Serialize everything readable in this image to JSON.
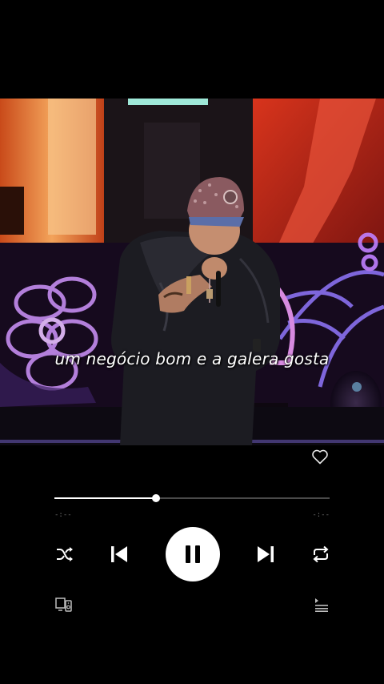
{
  "video": {
    "lyric_caption": "um negócio bom e a galera gosta"
  },
  "player": {
    "progress_fraction": 0.37,
    "elapsed_time": "-:--",
    "remaining_time": "-:--",
    "state": "playing"
  },
  "icons": {
    "like": "heart-outline-icon",
    "shuffle": "shuffle-icon",
    "previous": "skip-previous-icon",
    "pause": "pause-icon",
    "next": "skip-next-icon",
    "repeat": "repeat-icon",
    "devices": "connect-device-icon",
    "queue": "queue-list-icon"
  },
  "colors": {
    "background": "#000000",
    "accent": "#ffffff",
    "track": "#4a4a4a",
    "muted": "#6d6d6d"
  }
}
